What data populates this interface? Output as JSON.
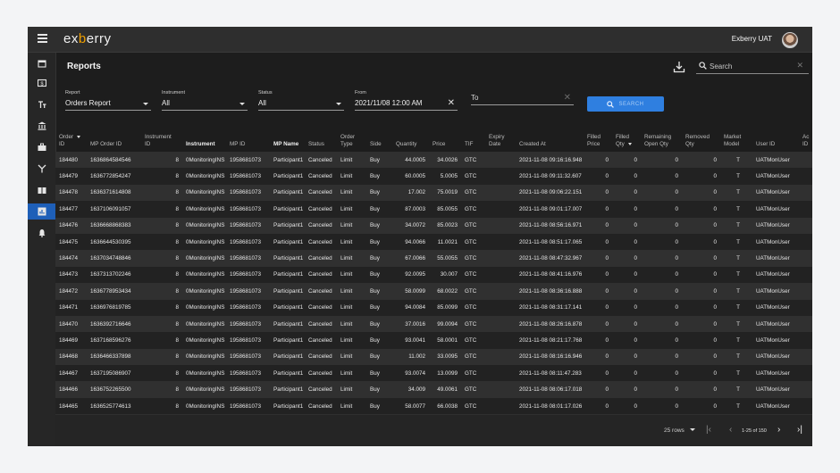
{
  "header": {
    "logo_left": "ex",
    "logo_accent": "b",
    "logo_right": "erry",
    "user": "Exberry UAT"
  },
  "page": {
    "title": "Reports"
  },
  "search": {
    "placeholder": "Search",
    "button": "SEARCH"
  },
  "filters": {
    "report": {
      "label": "Report",
      "value": "Orders Report"
    },
    "instrument": {
      "label": "Instrument",
      "value": "All"
    },
    "status": {
      "label": "Status",
      "value": "All"
    },
    "from": {
      "label": "From",
      "value": "2021/11/08 12:00 AM"
    },
    "to": {
      "label": "",
      "value": "To"
    }
  },
  "sidebar": {
    "icons": [
      "calendar-icon",
      "dollar-icon",
      "font-size-icon",
      "bank-icon",
      "briefcase-icon",
      "fork-icon",
      "book-icon",
      "report-icon",
      "bell-icon"
    ]
  },
  "table": {
    "headers": [
      [
        "Order",
        "ID"
      ],
      [
        "",
        "MP Order ID"
      ],
      [
        "Instrument",
        "ID"
      ],
      [
        "",
        "Instrument"
      ],
      [
        "",
        "MP ID"
      ],
      [
        "",
        "MP Name"
      ],
      [
        "",
        "Status"
      ],
      [
        "Order",
        "Type"
      ],
      [
        "",
        "Side"
      ],
      [
        "",
        "Quantity"
      ],
      [
        "",
        "Price"
      ],
      [
        "",
        "TIF"
      ],
      [
        "Expiry",
        "Date"
      ],
      [
        "",
        "Created At"
      ],
      [
        "Filled",
        "Price"
      ],
      [
        "Filled",
        "Qty"
      ],
      [
        "Remaining",
        "Open Qty"
      ],
      [
        "Removed",
        "Qty"
      ],
      [
        "Market",
        "Model"
      ],
      [
        "",
        "User ID"
      ],
      [
        "Ac",
        "ID"
      ]
    ],
    "rows": [
      [
        "184480",
        "1636864584546",
        "8",
        "0MonitoringINS",
        "1958681073",
        "Participant1",
        "Canceled",
        "Limit",
        "Buy",
        "44.0005",
        "34.0026",
        "GTC",
        "",
        "2021-11-08 09:16:16.948",
        "0",
        "0",
        "0",
        "0",
        "T",
        "UATMonUser",
        ""
      ],
      [
        "184479",
        "1636772854247",
        "8",
        "0MonitoringINS",
        "1958681073",
        "Participant1",
        "Canceled",
        "Limit",
        "Buy",
        "60.0005",
        "5.0005",
        "GTC",
        "",
        "2021-11-08 09:11:32.607",
        "0",
        "0",
        "0",
        "0",
        "T",
        "UATMonUser",
        ""
      ],
      [
        "184478",
        "1636371614808",
        "8",
        "0MonitoringINS",
        "1958681073",
        "Participant1",
        "Canceled",
        "Limit",
        "Buy",
        "17.002",
        "75.0019",
        "GTC",
        "",
        "2021-11-08 09:06:22.151",
        "0",
        "0",
        "0",
        "0",
        "T",
        "UATMonUser",
        ""
      ],
      [
        "184477",
        "1637106091057",
        "8",
        "0MonitoringINS",
        "1958681073",
        "Participant1",
        "Canceled",
        "Limit",
        "Buy",
        "87.0003",
        "85.0055",
        "GTC",
        "",
        "2021-11-08 09:01:17.007",
        "0",
        "0",
        "0",
        "0",
        "T",
        "UATMonUser",
        ""
      ],
      [
        "184476",
        "1636668868383",
        "8",
        "0MonitoringINS",
        "1958681073",
        "Participant1",
        "Canceled",
        "Limit",
        "Buy",
        "34.0072",
        "85.0023",
        "GTC",
        "",
        "2021-11-08 08:56:16.971",
        "0",
        "0",
        "0",
        "0",
        "T",
        "UATMonUser",
        ""
      ],
      [
        "184475",
        "1636644530395",
        "8",
        "0MonitoringINS",
        "1958681073",
        "Participant1",
        "Canceled",
        "Limit",
        "Buy",
        "94.0066",
        "11.0021",
        "GTC",
        "",
        "2021-11-08 08:51:17.065",
        "0",
        "0",
        "0",
        "0",
        "T",
        "UATMonUser",
        ""
      ],
      [
        "184474",
        "1637034748846",
        "8",
        "0MonitoringINS",
        "1958681073",
        "Participant1",
        "Canceled",
        "Limit",
        "Buy",
        "67.0066",
        "55.0055",
        "GTC",
        "",
        "2021-11-08 08:47:32.967",
        "0",
        "0",
        "0",
        "0",
        "T",
        "UATMonUser",
        ""
      ],
      [
        "184473",
        "1637313702246",
        "8",
        "0MonitoringINS",
        "1958681073",
        "Participant1",
        "Canceled",
        "Limit",
        "Buy",
        "92.0095",
        "30.007",
        "GTC",
        "",
        "2021-11-08 08:41:16.976",
        "0",
        "0",
        "0",
        "0",
        "T",
        "UATMonUser",
        ""
      ],
      [
        "184472",
        "1636778953434",
        "8",
        "0MonitoringINS",
        "1958681073",
        "Participant1",
        "Canceled",
        "Limit",
        "Buy",
        "58.0099",
        "68.0022",
        "GTC",
        "",
        "2021-11-08 08:36:16.888",
        "0",
        "0",
        "0",
        "0",
        "T",
        "UATMonUser",
        ""
      ],
      [
        "184471",
        "1636976819785",
        "8",
        "0MonitoringINS",
        "1958681073",
        "Participant1",
        "Canceled",
        "Limit",
        "Buy",
        "94.0084",
        "85.0099",
        "GTC",
        "",
        "2021-11-08 08:31:17.141",
        "0",
        "0",
        "0",
        "0",
        "T",
        "UATMonUser",
        ""
      ],
      [
        "184470",
        "1636392716646",
        "8",
        "0MonitoringINS",
        "1958681073",
        "Participant1",
        "Canceled",
        "Limit",
        "Buy",
        "37.0016",
        "99.0094",
        "GTC",
        "",
        "2021-11-08 08:26:16.878",
        "0",
        "0",
        "0",
        "0",
        "T",
        "UATMonUser",
        ""
      ],
      [
        "184469",
        "1637168596276",
        "8",
        "0MonitoringINS",
        "1958681073",
        "Participant1",
        "Canceled",
        "Limit",
        "Buy",
        "93.0041",
        "58.0001",
        "GTC",
        "",
        "2021-11-08 08:21:17.768",
        "0",
        "0",
        "0",
        "0",
        "T",
        "UATMonUser",
        ""
      ],
      [
        "184468",
        "1636466337898",
        "8",
        "0MonitoringINS",
        "1958681073",
        "Participant1",
        "Canceled",
        "Limit",
        "Buy",
        "11.002",
        "33.0095",
        "GTC",
        "",
        "2021-11-08 08:16:16.946",
        "0",
        "0",
        "0",
        "0",
        "T",
        "UATMonUser",
        ""
      ],
      [
        "184467",
        "1637195086907",
        "8",
        "0MonitoringINS",
        "1958681073",
        "Participant1",
        "Canceled",
        "Limit",
        "Buy",
        "93.0074",
        "13.0099",
        "GTC",
        "",
        "2021-11-08 08:11:47.283",
        "0",
        "0",
        "0",
        "0",
        "T",
        "UATMonUser",
        ""
      ],
      [
        "184466",
        "1636752265500",
        "8",
        "0MonitoringINS",
        "1958681073",
        "Participant1",
        "Canceled",
        "Limit",
        "Buy",
        "34.009",
        "49.0061",
        "GTC",
        "",
        "2021-11-08 08:06:17.018",
        "0",
        "0",
        "0",
        "0",
        "T",
        "UATMonUser",
        ""
      ],
      [
        "184465",
        "1636525774613",
        "8",
        "0MonitoringINS",
        "1958681073",
        "Participant1",
        "Canceled",
        "Limit",
        "Buy",
        "58.0077",
        "66.0038",
        "GTC",
        "",
        "2021-11-08 08:01:17.026",
        "0",
        "0",
        "0",
        "0",
        "T",
        "UATMonUser",
        ""
      ]
    ]
  },
  "pagination": {
    "rows_per_page": "25 rows",
    "range": "1-25 of 150"
  }
}
